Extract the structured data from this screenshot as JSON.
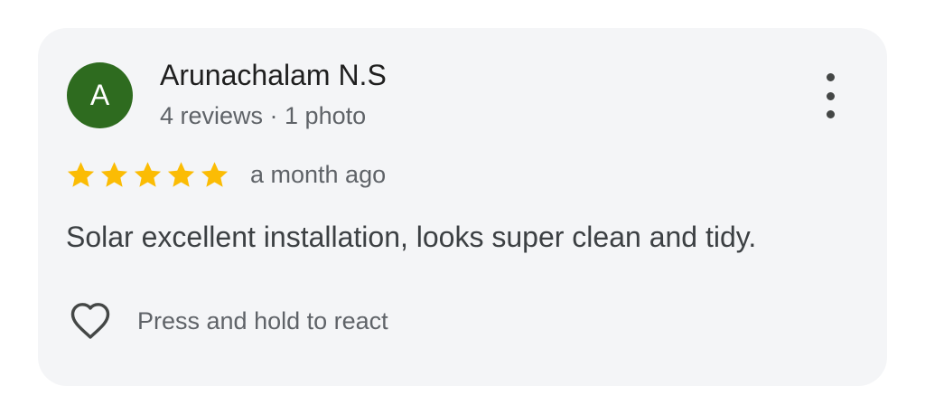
{
  "review": {
    "avatar_letter": "A",
    "avatar_color": "#2e6b1f",
    "author_name": "Arunachalam N.S",
    "author_meta": "4 reviews · 1 photo",
    "rating": 5,
    "rating_max": 5,
    "star_color": "#fbbc04",
    "time_ago": "a month ago",
    "text": "Solar excellent installation, looks super clean and tidy.",
    "more_icon": "more-vert-icon",
    "react_icon": "heart-outline-icon",
    "react_label": "Press and hold to react"
  }
}
